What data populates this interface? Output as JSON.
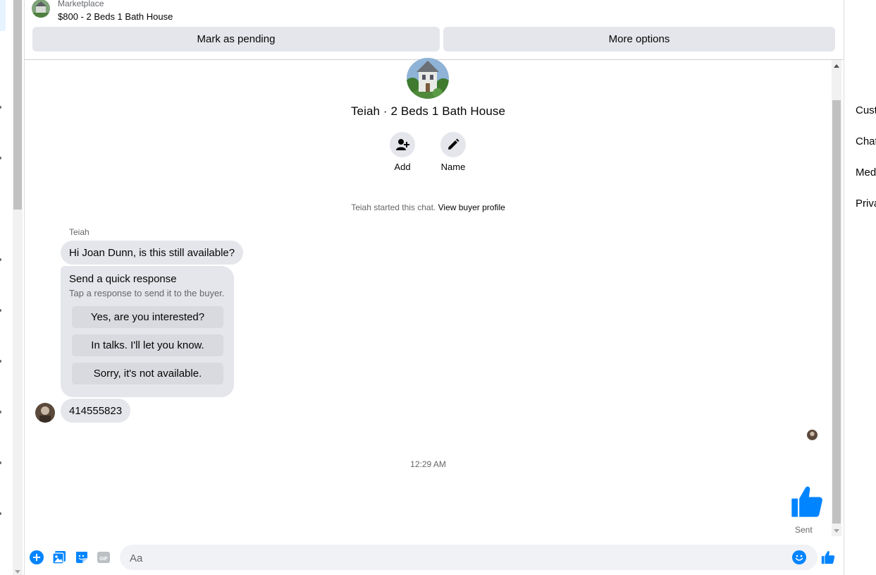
{
  "header": {
    "source_label": "Marketplace",
    "listing_title": "$800 - 2 Beds 1 Bath House",
    "mark_pending_label": "Mark as pending",
    "more_options_label": "More options"
  },
  "profile": {
    "title": "Teiah · 2 Beds 1 Bath House",
    "actions": [
      {
        "label": "Add",
        "icon": "add-person-icon"
      },
      {
        "label": "Name",
        "icon": "pencil-icon"
      }
    ]
  },
  "thread": {
    "started_text": "Teiah started this chat.",
    "view_profile_link": "View buyer profile",
    "sender_name": "Teiah",
    "first_message": "Hi Joan Dunn, is this still available?",
    "quick_response": {
      "title": "Send a quick response",
      "subtitle": "Tap a response to send it to the buyer.",
      "options": [
        "Yes, are you interested?",
        "In talks. I'll let you know.",
        "Sorry, it's not available."
      ]
    },
    "my_message": "414555823",
    "timestamp": "12:29 AM",
    "sent_status": "Sent"
  },
  "composer": {
    "placeholder": "Aa",
    "icons": [
      "plus-icon",
      "photo-icon",
      "sticker-icon",
      "gif-icon",
      "emoji-icon",
      "thumbs-up-icon"
    ],
    "gif_text": "GIF"
  },
  "right_panel": {
    "items": [
      "Customize chat",
      "Chat info",
      "Media, files and links",
      "Privacy & support"
    ]
  },
  "colors": {
    "accent": "#0084ff",
    "bubble": "#e4e6eb",
    "secondary_text": "#65676b"
  }
}
